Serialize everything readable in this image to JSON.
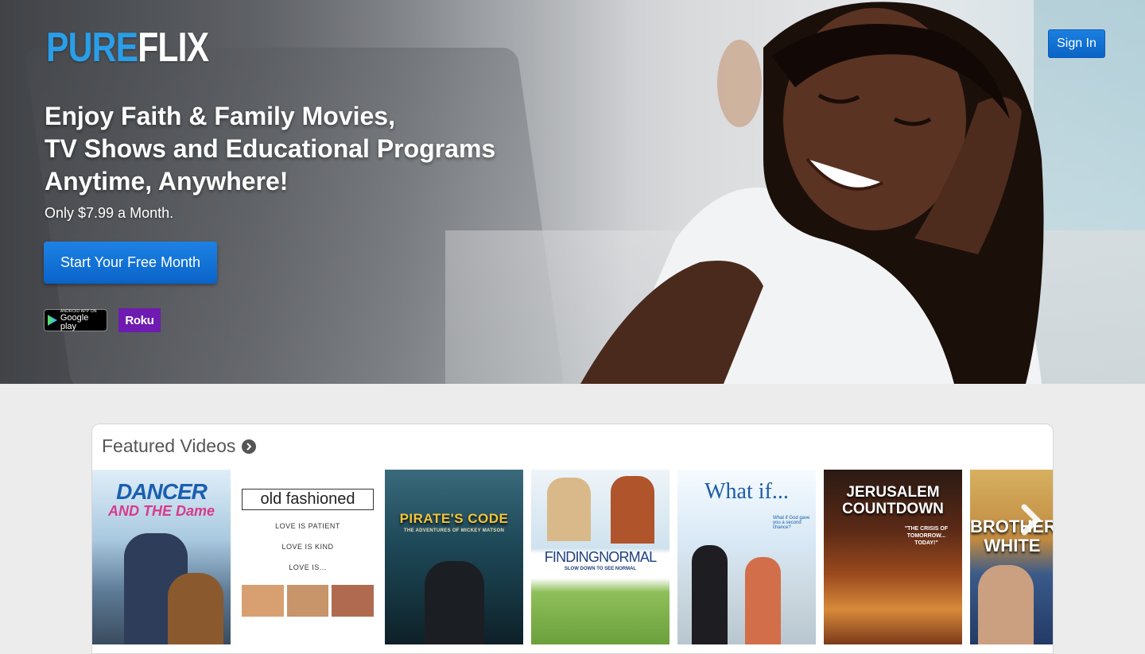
{
  "brand": {
    "pure": "PURE",
    "flix": "FLIX"
  },
  "header": {
    "signin_label": "Sign In"
  },
  "hero": {
    "headline_lines": [
      "Enjoy Faith & Family Movies,",
      "TV Shows and Educational Programs",
      "Anytime, Anywhere!"
    ],
    "price_text": "Only $7.99 a Month.",
    "cta_label": "Start Your Free Month",
    "google_play": {
      "small": "ANDROID APP ON",
      "big": "Google play"
    },
    "roku_label": "Roku"
  },
  "featured": {
    "title": "Featured Videos",
    "videos": [
      {
        "title": "DANCER",
        "subtitle": "AND THE Dame"
      },
      {
        "title": "old fashioned",
        "lines": [
          "LOVE IS PATIENT",
          "LOVE IS KIND",
          "LOVE IS..."
        ]
      },
      {
        "title": "PIRATE'S CODE",
        "subtitle": "THE ADVENTURES OF MICKEY MATSON"
      },
      {
        "title": "FINDINGNORMAL",
        "subtitle": "SLOW DOWN TO SEE NORMAL"
      },
      {
        "title": "What if...",
        "subtitle": "What if God gave you a second chance?"
      },
      {
        "title": "JERUSALEM COUNTDOWN",
        "subtitle": "\"THE CRISIS OF TOMORROW... TODAY!\""
      },
      {
        "title": "BROTHER WHITE",
        "subtitle": ""
      }
    ]
  },
  "colors": {
    "accent_blue": "#0a64c6",
    "logo_blue": "#2a9ee8",
    "roku_purple": "#6f1ab1"
  }
}
